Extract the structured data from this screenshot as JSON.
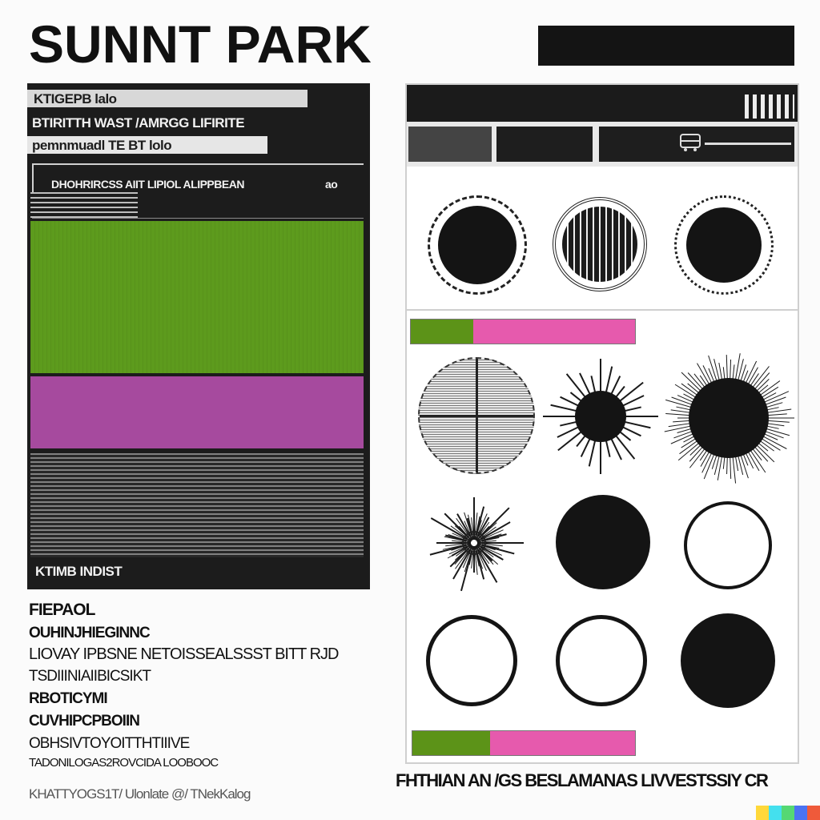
{
  "header": {
    "title": "SUNNT PARK"
  },
  "left_panel": {
    "line1": "KTIGEPB lalo",
    "line2": "BTIRITTH WAST /AMRGG LIFIRITE",
    "line3": "pemnmuadl TE BT lolo",
    "line4": "DHOHRIRCSS AIIT LIPIOL ALIPPBEAN",
    "line4_tag": "ao",
    "footer": "KTIMB INDIST",
    "swatch_colors": {
      "green": "#5d9b1d",
      "magenta": "#a64a9e",
      "panel": "#1c1c1c"
    }
  },
  "left_text": {
    "lines": [
      "FIEPAOL",
      "OUHINJHIEGINNC",
      "LIOVAY IPBSNE NETOISSEALSSST BITT RJD",
      "TSDIIINIAIIBICSIKT",
      "RBOTICYMI",
      "CUVHIPCPBOIIN",
      "OBHSIVTOYOITTHTIIIVE",
      "TADONILOGAS2ROVCIDA LOOBOOC",
      "KHATTYOGS1T/ Ulonlate @/ TNekKalog"
    ]
  },
  "right_panel": {
    "bar_colors": {
      "green": "#5c9318",
      "magenta": "#e65aad"
    },
    "bar1": {
      "green_fraction": 0.28
    },
    "bar2": {
      "green_fraction": 0.35
    },
    "circle_rows": [
      [
        "sunburst-ring",
        "striped-ring",
        "fringed-disc"
      ],
      [
        "hatched-globe",
        "spiky-sun",
        "fringed-sun"
      ],
      [
        "starburst",
        "solid-disc",
        "outline-ring"
      ],
      [
        "outline-ring",
        "outline-ring",
        "solid-disc"
      ]
    ]
  },
  "bottom_caption": "FHTHIAN AN /GS BESLAMANAS LIVVESTSSIY CR",
  "palette": [
    "#ffd83a",
    "#44e0ee",
    "#55d873",
    "#4b73f2",
    "#ef5a3a"
  ]
}
